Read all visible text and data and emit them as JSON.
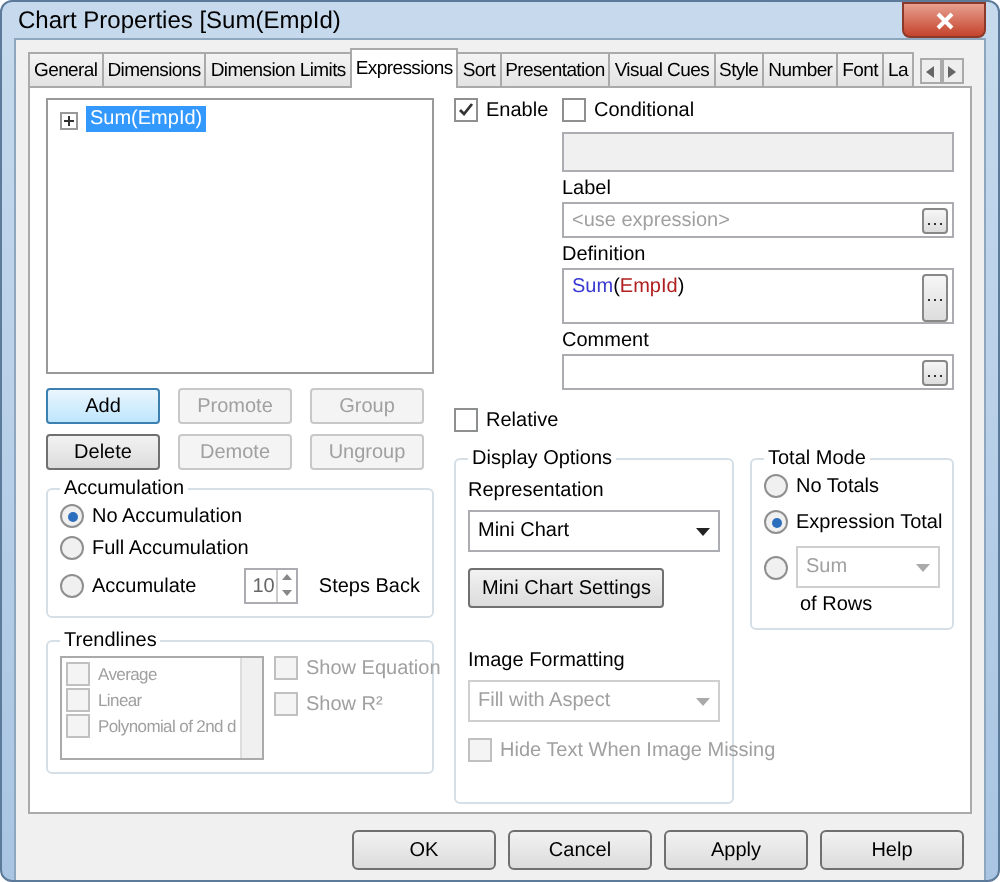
{
  "window": {
    "title": "Chart Properties [Sum(EmpId)"
  },
  "tabs": [
    {
      "label": "General",
      "selected": false
    },
    {
      "label": "Dimensions",
      "selected": false
    },
    {
      "label": "Dimension Limits",
      "selected": false
    },
    {
      "label": "Expressions",
      "selected": true
    },
    {
      "label": "Sort",
      "selected": false
    },
    {
      "label": "Presentation",
      "selected": false
    },
    {
      "label": "Visual Cues",
      "selected": false
    },
    {
      "label": "Style",
      "selected": false
    },
    {
      "label": "Number",
      "selected": false
    },
    {
      "label": "Font",
      "selected": false
    },
    {
      "label": "La",
      "selected": false
    }
  ],
  "expression_tree": [
    {
      "label": "Sum(EmpId)",
      "selected": true,
      "expanded": false
    }
  ],
  "enable": {
    "label": "Enable",
    "checked": true
  },
  "conditional": {
    "label": "Conditional",
    "checked": false
  },
  "label_field": {
    "label": "Label",
    "placeholder": "<use expression>"
  },
  "definition": {
    "label": "Definition",
    "tokens": [
      {
        "text": "Sum",
        "kind": "function"
      },
      {
        "text": "(",
        "kind": "plain"
      },
      {
        "text": "EmpId",
        "kind": "field"
      },
      {
        "text": ")",
        "kind": "plain"
      }
    ]
  },
  "comment": {
    "label": "Comment"
  },
  "expression_buttons": [
    {
      "label": "Add",
      "disabled": false,
      "focused": true
    },
    {
      "label": "Promote",
      "disabled": true,
      "focused": false
    },
    {
      "label": "Group",
      "disabled": true,
      "focused": false
    },
    {
      "label": "Delete",
      "disabled": false,
      "focused": false
    },
    {
      "label": "Demote",
      "disabled": true,
      "focused": false
    },
    {
      "label": "Ungroup",
      "disabled": true,
      "focused": false
    }
  ],
  "relative": {
    "label": "Relative",
    "checked": false
  },
  "accumulation": {
    "title": "Accumulation",
    "options": [
      {
        "label": "No Accumulation",
        "selected": true
      },
      {
        "label": "Full Accumulation",
        "selected": false
      },
      {
        "label": "Accumulate",
        "selected": false
      }
    ],
    "steps": {
      "value": "10",
      "label": "Steps Back"
    }
  },
  "trendlines": {
    "title": "Trendlines",
    "disabled": true,
    "items": [
      {
        "label": "Average",
        "checked": false
      },
      {
        "label": "Linear",
        "checked": false
      },
      {
        "label": "Polynomial of 2nd d",
        "checked": false
      }
    ],
    "show_equation": {
      "label": "Show Equation",
      "checked": false
    },
    "show_r2": {
      "label": "Show R²",
      "checked": false
    }
  },
  "display_options": {
    "title": "Display Options",
    "representation": {
      "label": "Representation",
      "value": "Mini Chart"
    },
    "settings_button": "Mini Chart Settings",
    "image_formatting": {
      "label": "Image Formatting",
      "value": "Fill with Aspect",
      "disabled": true
    },
    "hide_text": {
      "label": "Hide Text When Image Missing",
      "checked": false,
      "disabled": true
    }
  },
  "total_mode": {
    "title": "Total Mode",
    "options": [
      {
        "label": "No Totals",
        "selected": false,
        "kind": "plain"
      },
      {
        "label": "Expression Total",
        "selected": true,
        "kind": "plain"
      },
      {
        "value": "Sum",
        "suffix": "of Rows",
        "selected": false,
        "kind": "aggregate"
      }
    ]
  },
  "footer_buttons": [
    "OK",
    "Cancel",
    "Apply",
    "Help"
  ]
}
